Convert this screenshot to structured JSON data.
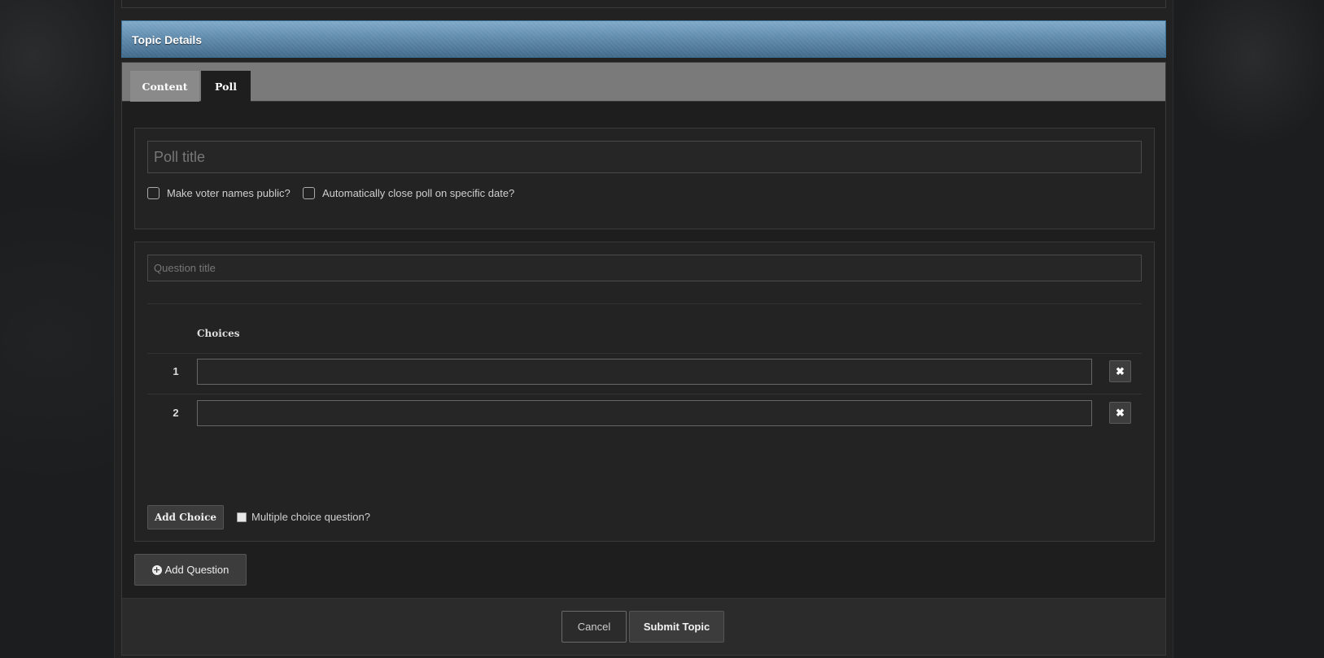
{
  "section": {
    "title": "Topic Details"
  },
  "tabs": [
    {
      "label": "Content",
      "active": false
    },
    {
      "label": "Poll",
      "active": true
    }
  ],
  "poll": {
    "title_placeholder": "Poll title",
    "title_value": "",
    "options": [
      {
        "label": "Make voter names public?",
        "checked": false
      },
      {
        "label": "Automatically close poll on specific date?",
        "checked": false
      }
    ]
  },
  "question": {
    "title_placeholder": "Question title",
    "title_value": "",
    "choices_header": "Choices",
    "choices": [
      {
        "number": "1",
        "value": ""
      },
      {
        "number": "2",
        "value": ""
      }
    ],
    "remove_glyph": "✖",
    "add_choice_label": "Add Choice",
    "multiple_choice_label": "Multiple choice question?",
    "multiple_choice_checked": false
  },
  "add_question_label": "Add Question",
  "icons": {
    "add_question": "plus-circle-icon",
    "remove_choice": "close-icon"
  },
  "footer": {
    "cancel_label": "Cancel",
    "submit_label": "Submit Topic"
  },
  "colors": {
    "header_blue": "#5d88aa",
    "panel_bg": "#1e1e1f",
    "tabbar_bg": "#7a7a7a"
  }
}
